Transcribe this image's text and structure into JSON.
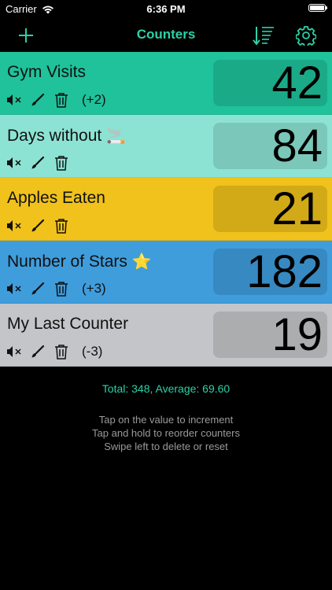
{
  "status_bar": {
    "carrier": "Carrier",
    "time": "6:36 PM"
  },
  "nav": {
    "title": "Counters",
    "add_icon": "plus-icon",
    "sort_icon": "sort-icon",
    "settings_icon": "gear-icon",
    "accent_color": "#2bd2a7"
  },
  "counters": [
    {
      "name": "Gym Visits",
      "value": "42",
      "delta": "(+2)",
      "color": "#1fc29b",
      "emoji": ""
    },
    {
      "name": "Days without",
      "value": "84",
      "delta": "",
      "color": "#8ce3d3",
      "emoji": "🚬"
    },
    {
      "name": "Apples Eaten",
      "value": "21",
      "delta": "",
      "color": "#f0c21b",
      "emoji": ""
    },
    {
      "name": "Number of Stars",
      "value": "182",
      "delta": "(+3)",
      "color": "#3f9ddc",
      "emoji": "⭐"
    },
    {
      "name": "My Last Counter",
      "value": "19",
      "delta": "(-3)",
      "color": "#c3c5c8",
      "emoji": ""
    }
  ],
  "footer": {
    "total": "Total: 348, Average: 69.60",
    "hints": [
      "Tap on the value to increment",
      "Tap and hold to reorder counters",
      "Swipe left to delete or reset"
    ]
  }
}
